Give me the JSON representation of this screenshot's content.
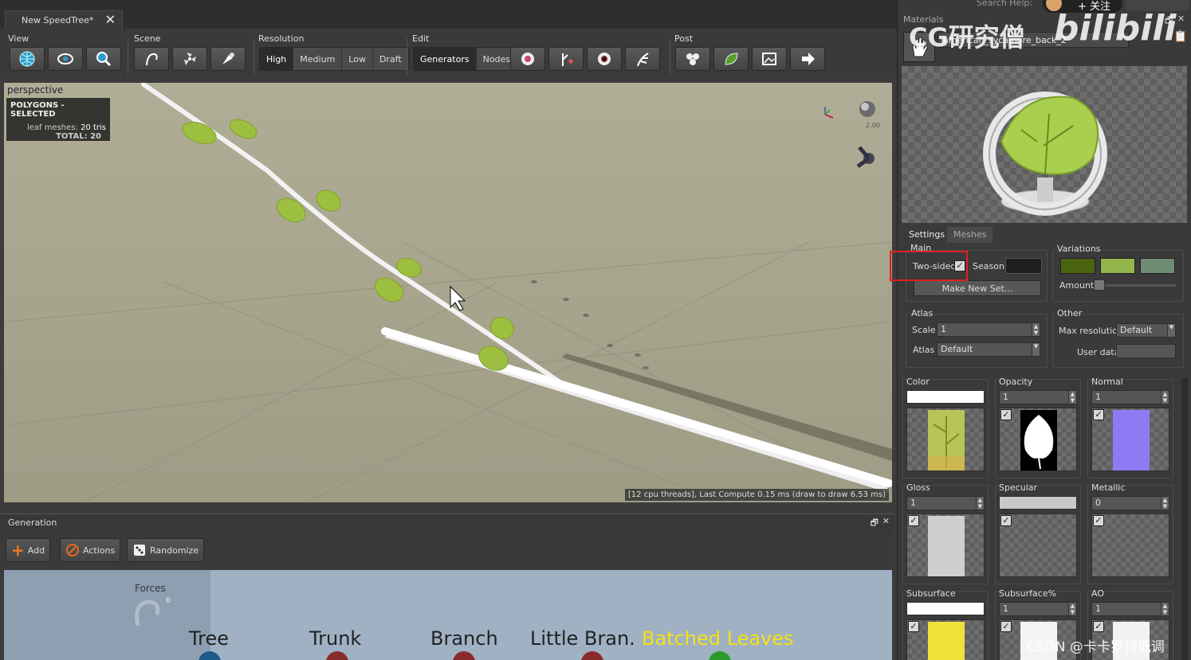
{
  "document_tab": {
    "title": "New SpeedTree*"
  },
  "search_help": "Search Help:",
  "toolbar": {
    "view_label": "View",
    "scene_label": "Scene",
    "resolution_label": "Resolution",
    "resolution_options": [
      "High",
      "Medium",
      "Low",
      "Draft"
    ],
    "edit_label": "Edit",
    "edit_modes": [
      "Generators",
      "Nodes"
    ],
    "post_label": "Post"
  },
  "viewport": {
    "title": "perspective",
    "stats_header": "POLYGONS - SELECTED",
    "stats_line1_label": "leaf meshes:",
    "stats_line1_value": "20 tris",
    "stats_total_label": "TOTAL:",
    "stats_total_value": "20",
    "gizmo_value": "2.00",
    "status": "[12 cpu threads], Last Compute 0.15 ms (draw to draw 6.53 ms)"
  },
  "generation": {
    "title": "Generation",
    "add_label": "Add",
    "actions_label": "Actions",
    "randomize_label": "Randomize",
    "forces_label": "Forces",
    "forces_value": "0",
    "nodes": [
      "Tree",
      "Trunk",
      "Branch",
      "Little Bran.",
      "Batched Leaves"
    ]
  },
  "materials": {
    "header": "Materials",
    "material_name": "american_sycamore_back_2",
    "tabs": [
      "Settings",
      "Meshes"
    ],
    "main_label": "Main",
    "two_sided_label": "Two-sided",
    "season_label": "Season",
    "make_new_set_label": "Make New Set...",
    "variations_label": "Variations",
    "amount_label": "Amount",
    "atlas_group_label": "Atlas",
    "scale_label": "Scale",
    "scale_value": "1",
    "atlas_label": "Atlas",
    "atlas_value": "Default",
    "other_label": "Other",
    "max_res_label": "Max resolution",
    "max_res_value": "Default",
    "user_data_label": "User data",
    "maps": [
      {
        "label": "Color",
        "value": ""
      },
      {
        "label": "Opacity",
        "value": "1"
      },
      {
        "label": "Normal",
        "value": "1"
      },
      {
        "label": "Gloss",
        "value": "1"
      },
      {
        "label": "Specular",
        "value": ""
      },
      {
        "label": "Metallic",
        "value": "0"
      },
      {
        "label": "Subsurface",
        "value": ""
      },
      {
        "label": "Subsurface%",
        "value": "1"
      },
      {
        "label": "AO",
        "value": "1"
      }
    ],
    "variation_colors": [
      "#4a6410",
      "#93b64a",
      "#6f8d72"
    ]
  },
  "watermarks": {
    "top": "CG研究僧",
    "bilibili": "bilibili",
    "follow": "+ 关注",
    "bottom": "CSDN @卡卡罗特低调"
  }
}
